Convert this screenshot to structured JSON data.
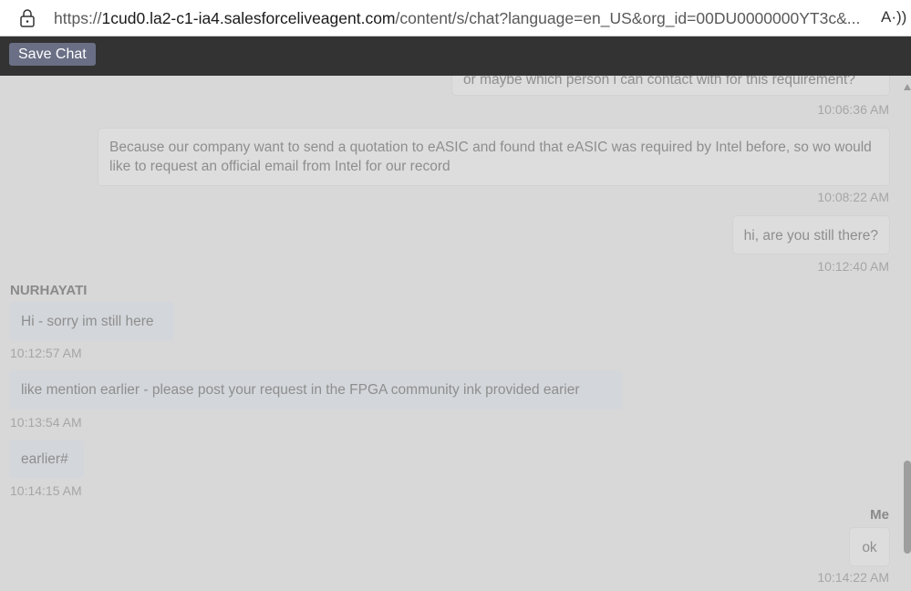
{
  "browser": {
    "url_prefix": "https://",
    "url_host": "1cud0.la2-c1-ia4.salesforceliveagent.com",
    "url_rest": "/content/s/chat?language=en_US&org_id=00DU0000000YT3c&...",
    "read_aloud_icon": "A·))"
  },
  "toolbar": {
    "save_label": "Save Chat"
  },
  "messages": [
    {
      "text": "or maybe which person i can contact with for this requirement?",
      "time": "10:06:36 AM"
    },
    {
      "text": "Because our company want to send a quotation to eASIC and found that eASIC was required by Intel before, so wo would like to request an official email from Intel for our record",
      "time": "10:08:22 AM"
    },
    {
      "text": "hi, are you still there?",
      "time": "10:12:40 AM"
    },
    {
      "sender": "NURHAYATI",
      "text": "Hi - sorry im still here",
      "time": "10:12:57 AM"
    },
    {
      "text": "like mention earlier - please post your request in the FPGA community ink provided earier",
      "time": "10:13:54 AM"
    },
    {
      "text": "earlier#",
      "time": "10:14:15 AM"
    },
    {
      "sender": "Me",
      "text": "ok",
      "time": "10:14:22 AM"
    }
  ]
}
